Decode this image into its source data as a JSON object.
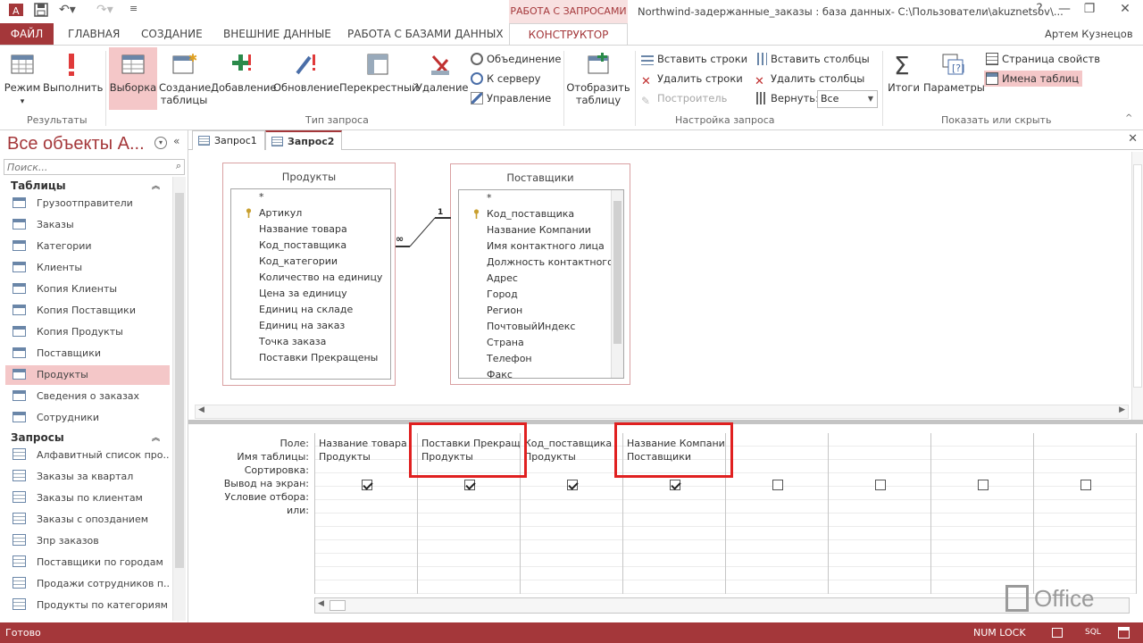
{
  "title_bar": {
    "context_tab_group": "РАБОТА С ЗАПРОСАМИ",
    "document_title": "Northwind-задержанные_заказы : база данных- C:\\Пользователи\\akuznetsov\\...",
    "user": "Артем Кузнецов",
    "help_glyph": "?",
    "minimize_glyph": "—",
    "restore_glyph": "❐",
    "close_glyph": "✕"
  },
  "tabs": {
    "file": "ФАЙЛ",
    "home": "ГЛАВНАЯ",
    "create": "СОЗДАНИЕ",
    "external": "ВНЕШНИЕ ДАННЫЕ",
    "db_tools": "РАБОТА С БАЗАМИ ДАННЫХ",
    "constructor": "КОНСТРУКТОР"
  },
  "ribbon": {
    "results": {
      "label": "Результаты",
      "view": "Режим",
      "run": "Выполнить"
    },
    "query_type": {
      "label": "Тип запроса",
      "select": "Выборка",
      "make_table_1": "Создание",
      "make_table_2": "таблицы",
      "append": "Добавление",
      "update": "Обновление",
      "crosstab": "Перекрестный",
      "delete": "Удаление",
      "union": "Объединение",
      "pass_through": "К серверу",
      "data_def": "Управление"
    },
    "setup": {
      "label": "Настройка запроса",
      "show_table_1": "Отобразить",
      "show_table_2": "таблицу",
      "insert_rows": "Вставить строки",
      "delete_rows": "Удалить строки",
      "builder": "Построитель",
      "insert_cols": "Вставить столбцы",
      "delete_cols": "Удалить столбцы",
      "return": "Вернуть:",
      "return_value": "Все"
    },
    "show_hide": {
      "label": "Показать или скрыть",
      "totals": "Итоги",
      "parameters": "Параметры",
      "property_sheet": "Страница свойств",
      "table_names": "Имена таблиц"
    }
  },
  "nav": {
    "title": "Все объекты А...",
    "search_placeholder": "Поиск...",
    "tables_header": "Таблицы",
    "tables": [
      "Грузоотправители",
      "Заказы",
      "Категории",
      "Клиенты",
      "Копия Клиенты",
      "Копия Поставщики",
      "Копия Продукты",
      "Поставщики",
      "Продукты",
      "Сведения о заказах",
      "Сотрудники"
    ],
    "queries_header": "Запросы",
    "queries": [
      "Алфавитный список про...",
      "Заказы за квартал",
      "Заказы по клиентам",
      "Заказы с опозданием",
      "Зпр заказов",
      "Поставщики по городам",
      "Продажи сотрудников п...",
      "Продукты по категориям"
    ]
  },
  "doc_tabs": [
    "Запрос1",
    "Запрос2"
  ],
  "tables": {
    "products": {
      "title": "Продукты",
      "fields": [
        "*",
        "Артикул",
        "Название товара",
        "Код_поставщика",
        "Код_категории",
        "Количество на единицу",
        "Цена за единицу",
        "Единиц на складе",
        "Единиц на заказ",
        "Точка заказа",
        "Поставки Прекращены"
      ]
    },
    "suppliers": {
      "title": "Поставщики",
      "fields": [
        "*",
        "Код_поставщика",
        "Название Компании",
        "Имя контактного лица",
        "Должность контактного л",
        "Адрес",
        "Город",
        "Регион",
        "ПочтовыйИндекс",
        "Страна",
        "Телефон",
        "Факс"
      ]
    },
    "relation": {
      "one": "1",
      "many": "∞"
    }
  },
  "grid": {
    "row_labels": [
      "Поле:",
      "Имя таблицы:",
      "Сортировка:",
      "Вывод на экран:",
      "Условие отбора:",
      "или:"
    ],
    "columns": [
      {
        "field": "Название товара",
        "table": "Продукты",
        "show": true
      },
      {
        "field": "Поставки Прекращены",
        "table": "Продукты",
        "show": true
      },
      {
        "field": "Код_поставщика",
        "table": "Продукты",
        "show": true
      },
      {
        "field": "Название Компании",
        "table": "Поставщики",
        "show": true
      },
      {
        "field": "",
        "table": "",
        "show": false
      },
      {
        "field": "",
        "table": "",
        "show": false
      },
      {
        "field": "",
        "table": "",
        "show": false
      },
      {
        "field": "",
        "table": "",
        "show": false
      }
    ]
  },
  "office_logo": "Office",
  "status": {
    "ready": "Готово",
    "numlock": "NUM LOCK",
    "sql": "SQL"
  },
  "colors": {
    "accent": "#a4373a",
    "selected": "#f4c7c8",
    "highlight_box": "#e02020"
  }
}
